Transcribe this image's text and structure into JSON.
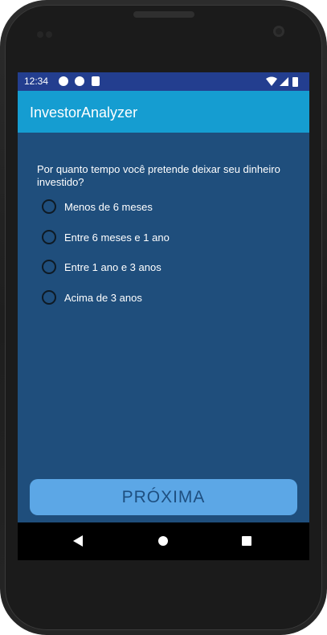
{
  "status_bar": {
    "time": "12:34",
    "left_icons": [
      "play-circle-icon",
      "shield-icon",
      "sd-card-icon"
    ],
    "right_icons": [
      "wifi-icon",
      "signal-icon",
      "battery-icon"
    ]
  },
  "app_bar": {
    "title": "InvestorAnalyzer",
    "color": "#159DD1"
  },
  "question": {
    "text": "Por quanto tempo você pretende deixar seu dinheiro investido?",
    "options": [
      {
        "label": "Menos de 6 meses",
        "selected": false
      },
      {
        "label": "Entre 6 meses e 1 ano",
        "selected": false
      },
      {
        "label": "Entre 1 ano e 3 anos",
        "selected": false
      },
      {
        "label": "Acima de 3 anos",
        "selected": false
      }
    ]
  },
  "next_button": {
    "label": "PRÓXIMA"
  },
  "colors": {
    "status_bar": "#233E8F",
    "content_background": "#1F4E7C",
    "button_background": "#5CA7E6",
    "button_text": "#1E4F80"
  },
  "nav_bar": {
    "buttons": [
      "back-icon",
      "home-icon",
      "recents-icon"
    ]
  }
}
